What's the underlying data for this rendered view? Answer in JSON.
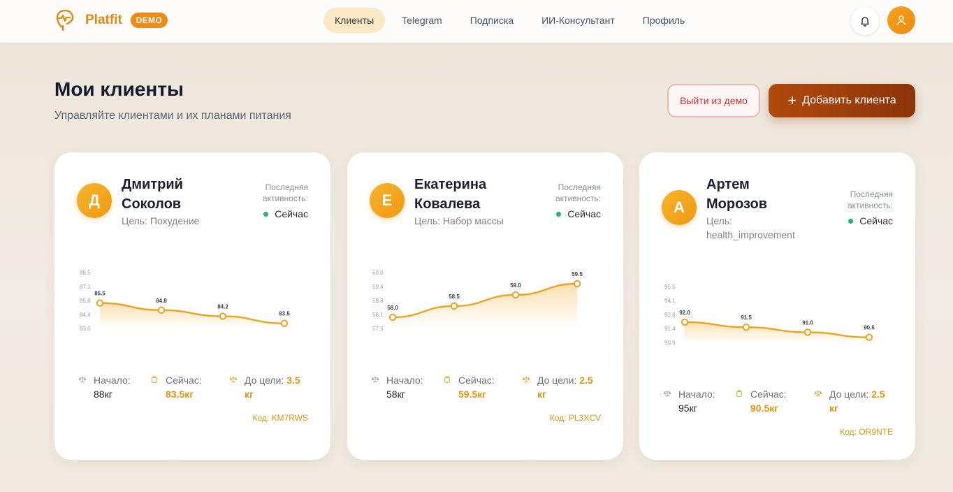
{
  "app": {
    "name": "Platfit",
    "badge": "DEMO"
  },
  "nav": [
    {
      "label": "Клиенты",
      "active": true
    },
    {
      "label": "Telegram",
      "active": false
    },
    {
      "label": "Подписка",
      "active": false
    },
    {
      "label": "ИИ-Консультант",
      "active": false
    },
    {
      "label": "Профиль",
      "active": false
    }
  ],
  "icons": {
    "logo": "heart-pulse-icon",
    "bell": "bell-icon",
    "user": "user-icon",
    "plus": "plus-icon",
    "scale": "scale-icon",
    "clipboard": "clipboard-icon"
  },
  "colors": {
    "accent": "#ee8a16",
    "primary_button": "#a3420c",
    "status_online": "#1fb57a",
    "danger": "#d0312d"
  },
  "header": {
    "title": "Мои клиенты",
    "subtitle": "Управляйте клиентами и их планами питания",
    "exit_demo": "Выйти из демо",
    "add_client": "Добавить клиента"
  },
  "labels": {
    "last_activity": "Последняя активность:",
    "start": "Начало:",
    "now": "Сейчас:",
    "to_goal": "До цели:"
  },
  "clients": [
    {
      "initial": "Д",
      "name": "Дмитрий Соколов",
      "goal": "Цель: Похудение",
      "status": "Сейчас",
      "start": "88кг",
      "current": "83.5кг",
      "to_goal": "3.5 кг",
      "code": "Код: KM7RWS",
      "chart_data": {
        "type": "area",
        "values": [
          85.5,
          84.8,
          84.2,
          83.5
        ],
        "labels": [
          "85.5",
          "84.8",
          "84.2",
          "83.5"
        ],
        "yticks": [
          "88.5",
          "87.1",
          "85.8",
          "84.4",
          "83.0"
        ],
        "ylim": [
          83.0,
          88.5
        ]
      }
    },
    {
      "initial": "Е",
      "name": "Екатерина Ковалева",
      "goal": "Цель: Набор массы",
      "status": "Сейчас",
      "start": "58кг",
      "current": "59.5кг",
      "to_goal": "2.5 кг",
      "code": "Код: PL3XCV",
      "chart_data": {
        "type": "area",
        "values": [
          58.0,
          58.5,
          59.0,
          59.5
        ],
        "labels": [
          "58.0",
          "58.5",
          "59.0",
          "59.5"
        ],
        "yticks": [
          "60.0",
          "59.4",
          "58.8",
          "58.1",
          "57.5"
        ],
        "ylim": [
          57.5,
          60.0
        ]
      }
    },
    {
      "initial": "А",
      "name": "Артем Морозов",
      "goal": "Цель: health_improvement",
      "status": "Сейчас",
      "start": "95кг",
      "current": "90.5кг",
      "to_goal": "2.5 кг",
      "code": "Код: OR9NTE",
      "chart_data": {
        "type": "area",
        "values": [
          92.0,
          91.5,
          91.0,
          90.5
        ],
        "labels": [
          "92.0",
          "91.5",
          "91.0",
          "90.5"
        ],
        "yticks": [
          "95.5",
          "94.1",
          "92.8",
          "91.4",
          "90.0"
        ],
        "ylim": [
          90.0,
          95.5
        ]
      }
    }
  ]
}
